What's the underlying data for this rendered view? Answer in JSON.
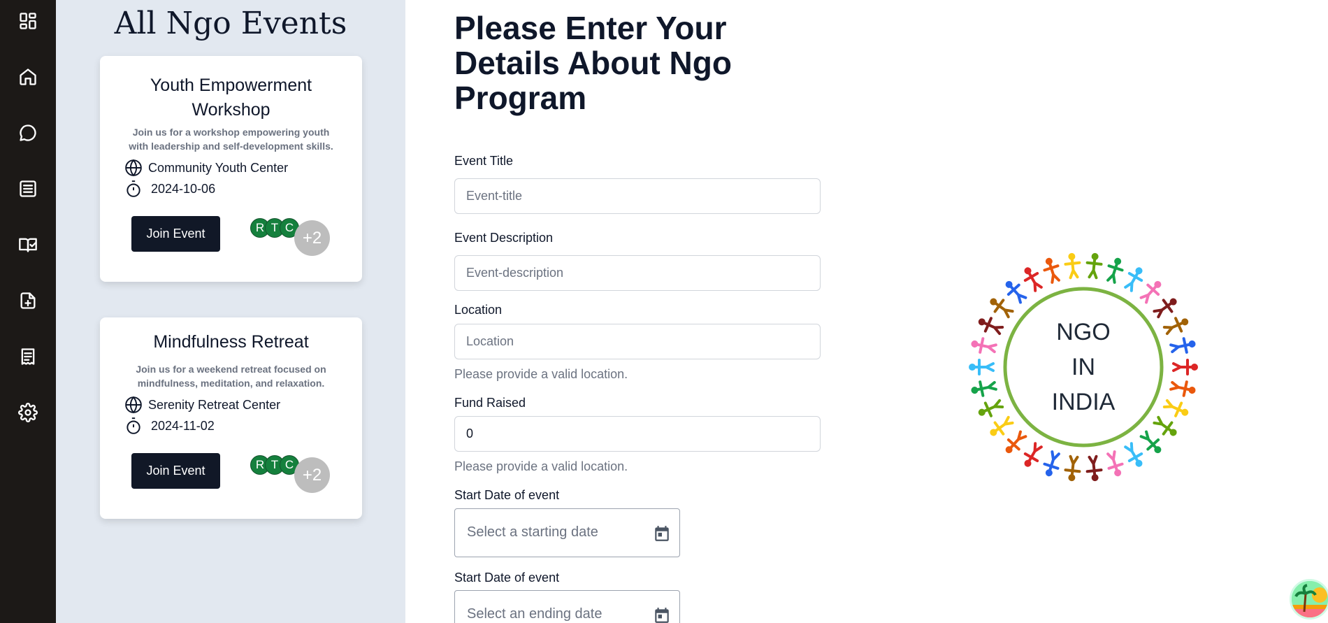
{
  "sidebar": {
    "items": [
      {
        "icon": "dashboard-icon"
      },
      {
        "icon": "home-icon"
      },
      {
        "icon": "chat-icon"
      },
      {
        "icon": "list-icon"
      },
      {
        "icon": "book-check-icon"
      },
      {
        "icon": "file-plus-icon"
      },
      {
        "icon": "receipt-icon"
      },
      {
        "icon": "settings-icon"
      }
    ]
  },
  "events_panel": {
    "title": "All Ngo Events",
    "cards": [
      {
        "title_line1": "Youth Empowerment",
        "title_line2": "Workshop",
        "desc_line1": "Join us for a workshop empowering youth",
        "desc_line2": "with leadership and self-development skills.",
        "location": "Community Youth Center",
        "date": "2024-10-06",
        "button": "Join Event",
        "avatars": [
          "R",
          "T",
          "C"
        ],
        "more": "+2"
      },
      {
        "title_line1": "Mindfulness Retreat",
        "desc_line1": "Join us for a weekend retreat focused on",
        "desc_line2": "mindfulness, meditation, and relaxation.",
        "location": "Serenity Retreat Center",
        "date": "2024-11-02",
        "button": "Join Event",
        "avatars": [
          "R",
          "T",
          "C"
        ],
        "more": "+2"
      }
    ]
  },
  "form": {
    "heading_line1": "Please Enter Your",
    "heading_line2": "Details About Ngo",
    "heading_line3": "Program",
    "event_title": {
      "label": "Event Title",
      "placeholder": "Event-title",
      "value": ""
    },
    "event_description": {
      "label": "Event Description",
      "placeholder": "Event-description",
      "value": ""
    },
    "location": {
      "label": "Location",
      "placeholder": "Location",
      "value": "",
      "hint": "Please provide a valid location."
    },
    "fund_raised": {
      "label": "Fund Raised",
      "value": "0",
      "hint": "Please provide a valid location."
    },
    "start_date": {
      "label": "Start Date of event",
      "placeholder": "Select a starting date"
    },
    "end_date": {
      "label": "Start Date of event",
      "placeholder": "Select an ending date"
    }
  },
  "logo": {
    "line1": "NGO",
    "line2": "IN",
    "line3": "INDIA",
    "ring_colors": [
      "#dc2626",
      "#ea580c",
      "#facc15",
      "#65a30d",
      "#16a34a",
      "#38bdf8",
      "#f472b6",
      "#7f1d1d",
      "#a16207",
      "#2563eb"
    ]
  }
}
